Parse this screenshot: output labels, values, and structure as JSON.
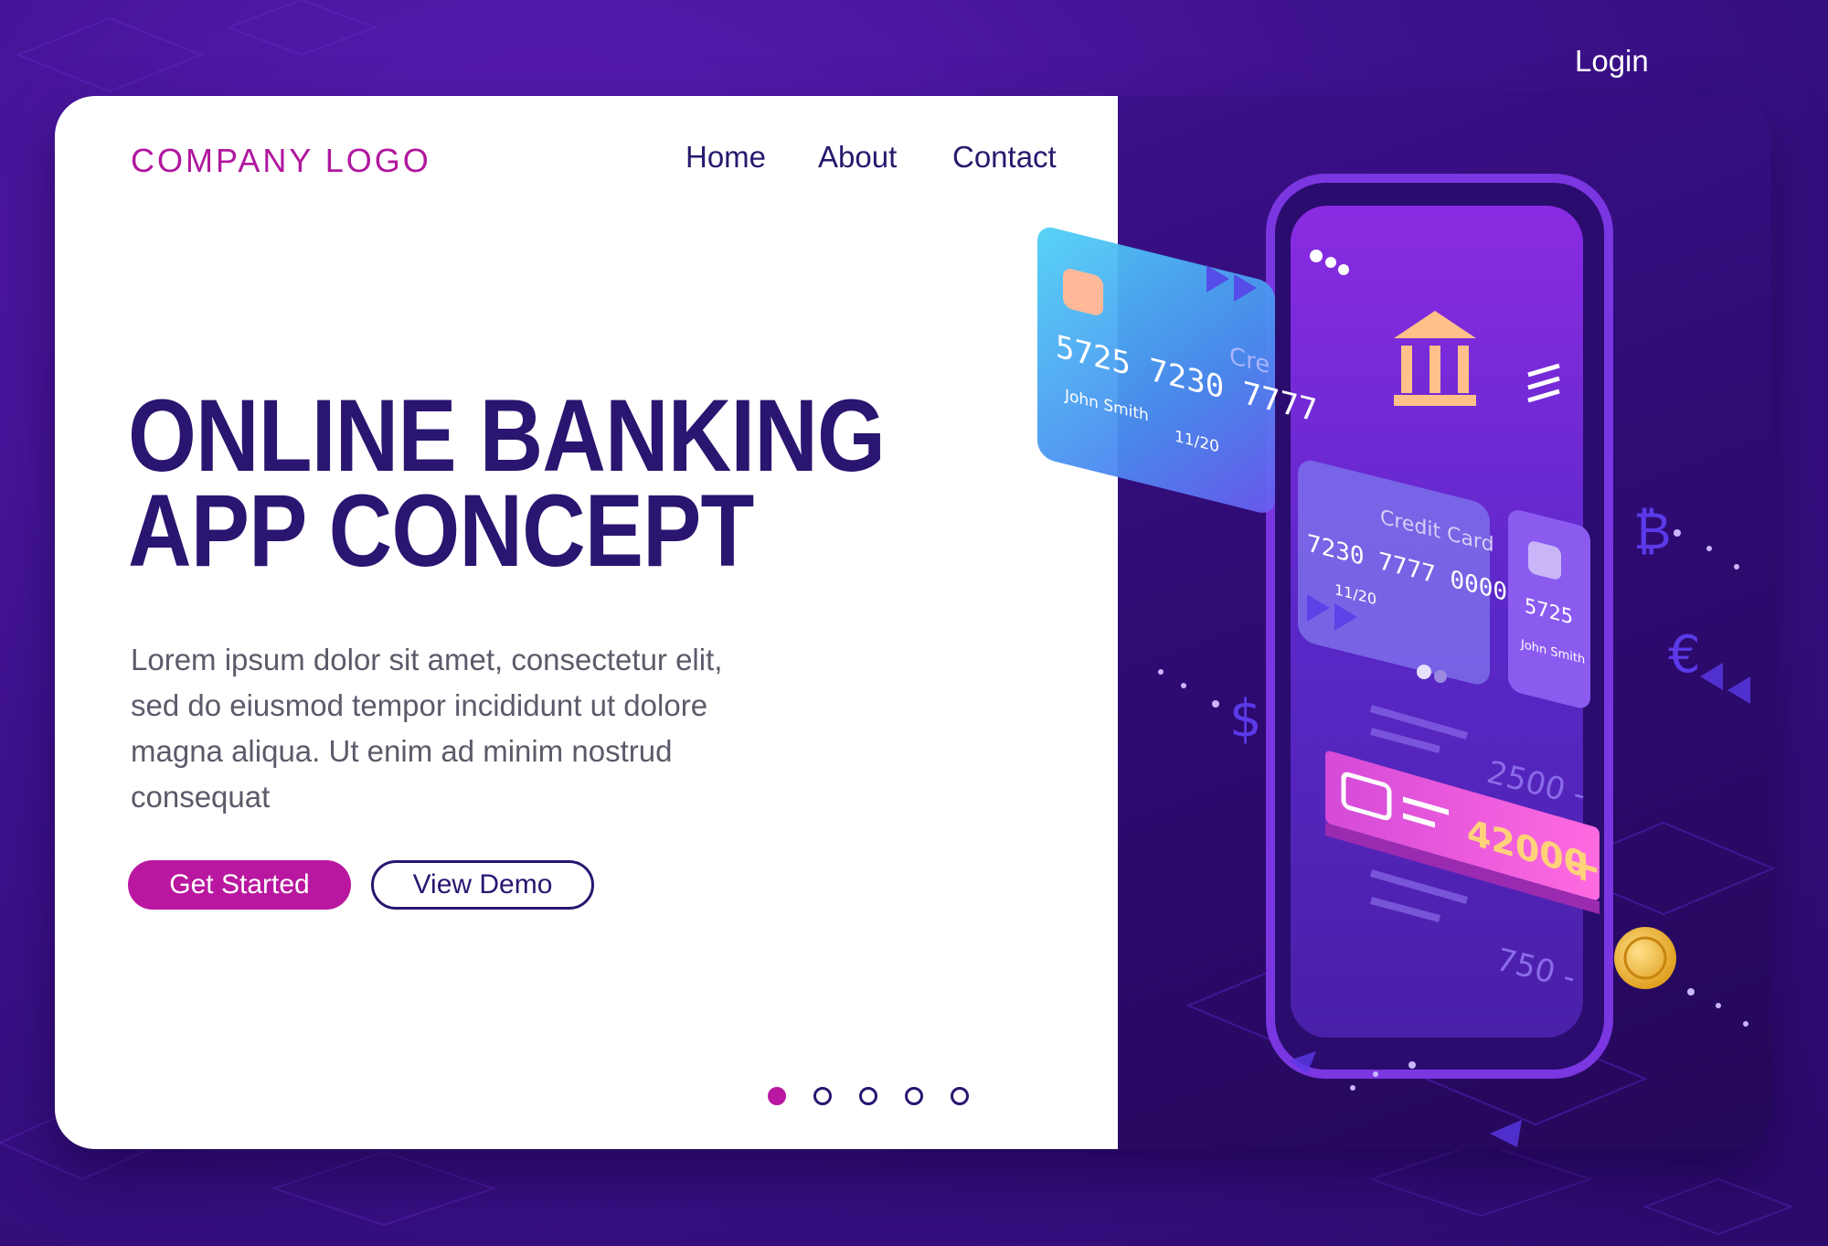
{
  "header": {
    "logo": "COMPANY LOGO",
    "nav": [
      {
        "label": "Home"
      },
      {
        "label": "About"
      },
      {
        "label": "Contact"
      }
    ],
    "login": "Login"
  },
  "hero": {
    "title_line1": "ONLINE BANKING",
    "title_line2": "APP CONCEPT",
    "body": "Lorem ipsum dolor sit amet, consectetur elit, sed do eiusmod tempor incididunt ut dolore magna aliqua. Ut enim ad minim nostrud consequat",
    "primary_button": "Get Started",
    "secondary_button": "View Demo"
  },
  "pagination": {
    "total": 5,
    "active": 1
  },
  "illustration": {
    "front_card": {
      "number": "5725 7230 7777",
      "holder": "John Smith",
      "expiry": "11/20",
      "label": "Cre"
    },
    "phone_card": {
      "label": "Credit Card",
      "number": "7230 7777 0000",
      "expiry": "11/20"
    },
    "side_card": {
      "number": "5725",
      "holder": "John Smith"
    },
    "amounts": {
      "amount_1": "2500 -",
      "highlight": "42000",
      "amount_2": "750 -"
    },
    "currency_symbols": [
      "₿",
      "€",
      "$"
    ]
  },
  "colors": {
    "accent": "#b9179f",
    "title": "#2a1570",
    "background": "#3f1290",
    "body_text": "#5c5a6a"
  }
}
